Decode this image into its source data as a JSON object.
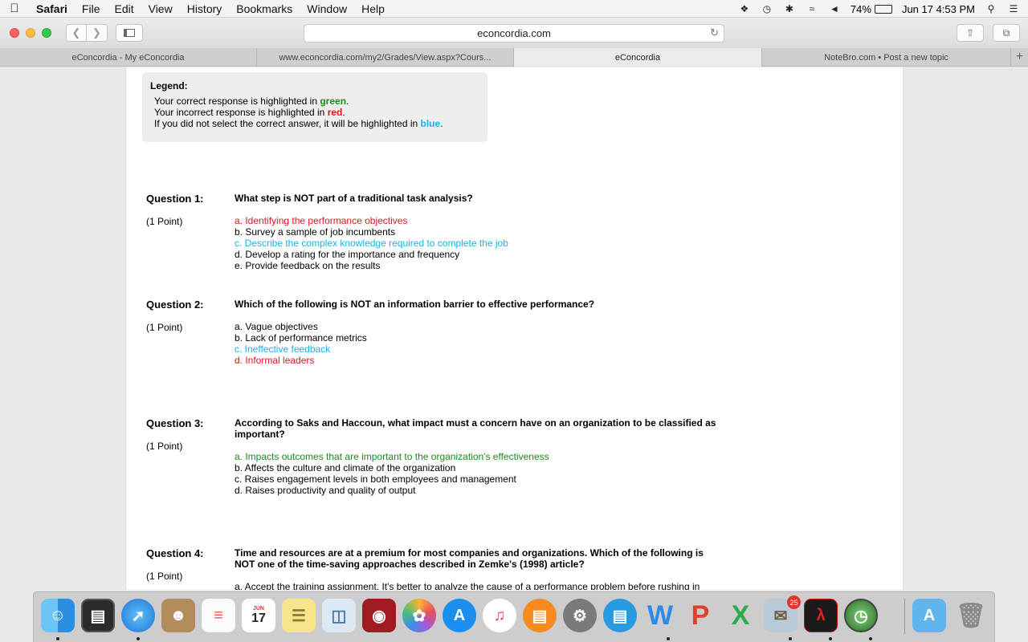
{
  "menubar": {
    "app": "Safari",
    "items": [
      "File",
      "Edit",
      "View",
      "History",
      "Bookmarks",
      "Window",
      "Help"
    ],
    "battery": "74%",
    "battery_level": 0.74,
    "clock": "Jun 17  4:53 PM"
  },
  "toolbar": {
    "address": "econcordia.com"
  },
  "tabs": [
    {
      "label": "eConcordia - My eConcordia",
      "active": false
    },
    {
      "label": "www.econcordia.com/my2/Grades/View.aspx?Cours...",
      "active": false
    },
    {
      "label": "eConcordia",
      "active": true
    },
    {
      "label": "NoteBro.com • Post a new topic",
      "active": false
    }
  ],
  "legend": {
    "title": "Legend:",
    "correct_prefix": "Your correct response is highlighted in ",
    "correct_word": "green",
    "incorrect_prefix": "Your incorrect response is highlighted in ",
    "incorrect_word": "red",
    "missed_prefix": "If you did not select the correct answer, it will be highlighted in ",
    "missed_word": "blue",
    "period": "."
  },
  "questions": [
    {
      "label": "Question 1:",
      "points": "(1 Point)",
      "text": "What step is NOT part of a traditional task analysis?",
      "options": [
        {
          "text": "a. Identifying the performance objectives",
          "status": "red"
        },
        {
          "text": "b. Survey a sample of job incumbents",
          "status": "none"
        },
        {
          "text": "c. Describe the complex knowledge required to complete the job",
          "status": "blue"
        },
        {
          "text": "d. Develop a rating for the importance and frequency",
          "status": "none"
        },
        {
          "text": "e. Provide feedback on the results",
          "status": "none"
        }
      ]
    },
    {
      "label": "Question 2:",
      "points": "(1 Point)",
      "text": "Which of the following is NOT an information barrier to effective performance?",
      "options": [
        {
          "text": "a. Vague objectives",
          "status": "none"
        },
        {
          "text": "b. Lack of performance metrics",
          "status": "none"
        },
        {
          "text": "c. Ineffective feedback",
          "status": "blue"
        },
        {
          "text": "d. Informal leaders",
          "status": "red"
        }
      ]
    },
    {
      "label": "Question 3:",
      "points": "(1 Point)",
      "text": "According to Saks and Haccoun, what impact must a concern have on an organization to be classified as important?",
      "options": [
        {
          "text": "a. Impacts outcomes that are important to the organization's effectiveness",
          "status": "green"
        },
        {
          "text": "b. Affects the culture and climate of the organization",
          "status": "none"
        },
        {
          "text": "c. Raises engagement levels in both employees and management",
          "status": "none"
        },
        {
          "text": "d. Raises productivity and quality of output",
          "status": "none"
        }
      ]
    },
    {
      "label": "Question 4:",
      "points": "(1 Point)",
      "text": "Time and resources are at a premium for most companies and organizations. Which of the following is NOT one of the time-saving approaches described in Zemke's (1998) article?",
      "options": [
        {
          "text": "a. Accept the training assignment. It's better to analyze the cause of a performance problem before rushing in",
          "status": "none"
        }
      ]
    }
  ],
  "dock": {
    "calendar_month": "JUN",
    "calendar_day": "17",
    "mail_badge": "25",
    "icons": [
      "finder-icon",
      "dashboard-icon",
      "safari-icon",
      "contacts-icon",
      "reminders-icon",
      "calendar-icon",
      "notes-icon",
      "preview-icon",
      "photo-booth-icon",
      "photos-icon",
      "app-store-icon",
      "itunes-icon",
      "ibooks-icon",
      "system-preferences-icon",
      "notebro-icon",
      "word-icon",
      "powerpoint-icon",
      "excel-icon",
      "mail-icon",
      "acrobat-icon",
      "time-machine-icon",
      "applications-folder-icon",
      "trash-icon"
    ]
  }
}
